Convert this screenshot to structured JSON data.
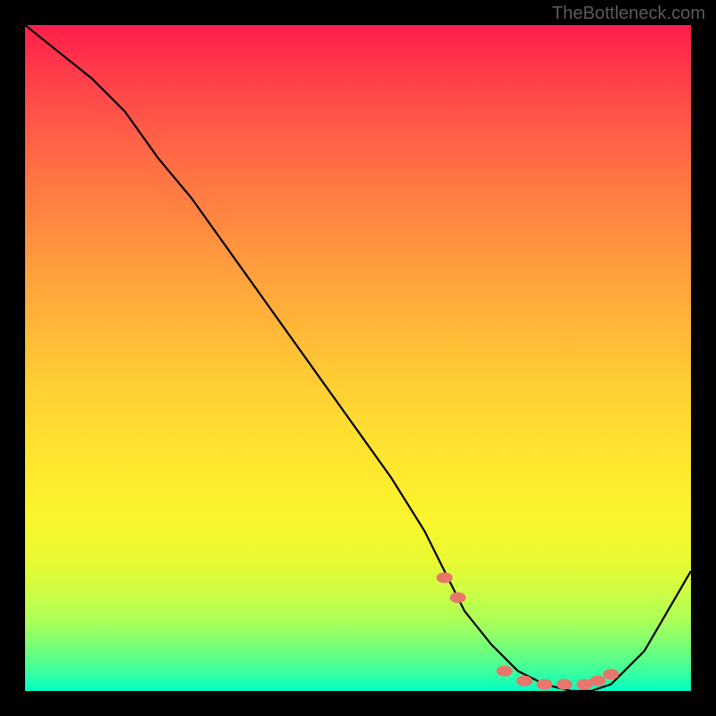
{
  "watermark": "TheBottleneck.com",
  "chart_data": {
    "type": "line",
    "title": "",
    "xlabel": "",
    "ylabel": "",
    "xlim": [
      0,
      100
    ],
    "ylim": [
      0,
      100
    ],
    "grid": false,
    "background_gradient": {
      "top": "#ff1e4a",
      "bottom": "#00ffc8",
      "description": "vertical red-to-green gradient representing bottleneck severity"
    },
    "series": [
      {
        "name": "bottleneck-curve",
        "color": "#000000",
        "x": [
          0,
          5,
          10,
          15,
          20,
          25,
          30,
          35,
          40,
          45,
          50,
          55,
          60,
          63,
          66,
          70,
          74,
          78,
          82,
          85,
          88,
          93,
          100
        ],
        "y": [
          100,
          96,
          92,
          87,
          80,
          74,
          67,
          60,
          53,
          46,
          39,
          32,
          24,
          18,
          12,
          7,
          3,
          1,
          0,
          0,
          1,
          6,
          18
        ]
      },
      {
        "name": "highlight-dots",
        "color": "#e8766a",
        "type": "scatter",
        "x": [
          63,
          65,
          72,
          75,
          78,
          81,
          84,
          86,
          88
        ],
        "y": [
          17,
          14,
          3,
          1.5,
          1,
          1,
          1,
          1.5,
          2.5
        ]
      }
    ]
  }
}
